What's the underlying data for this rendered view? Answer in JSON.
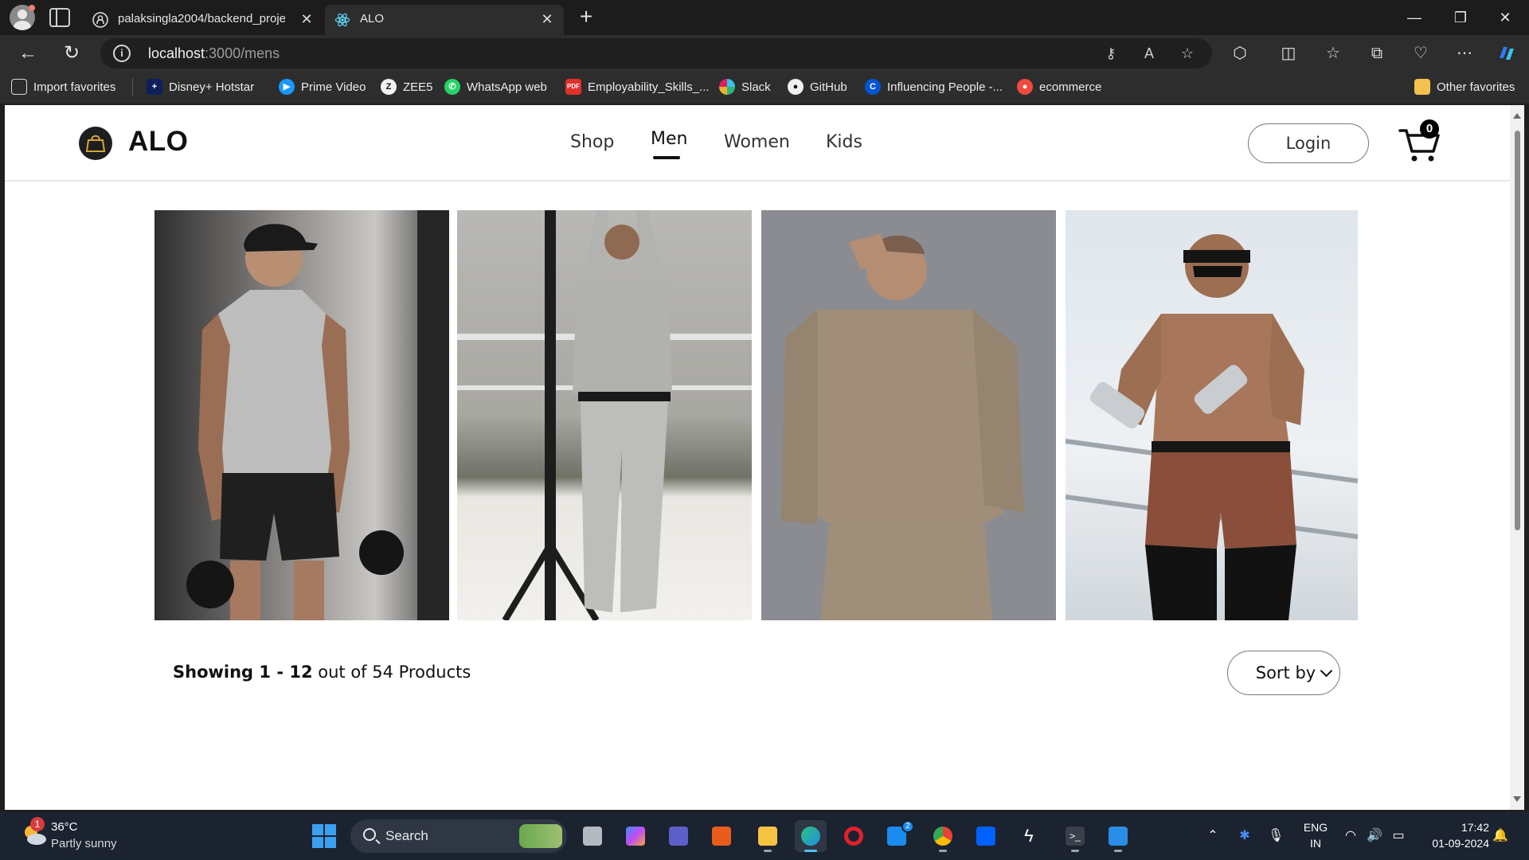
{
  "browser": {
    "tabs": [
      {
        "title": "palaksingla2004/backend_project",
        "icon": "github-icon",
        "active": false
      },
      {
        "title": "ALO",
        "icon": "react-icon",
        "active": true
      }
    ],
    "address": {
      "host": "localhost",
      "path": ":3000/mens"
    },
    "window_controls": {
      "minimize": "—",
      "restore": "❐",
      "close": "✕"
    },
    "favorites": [
      {
        "label": "Import favorites",
        "icon": "import-icon"
      },
      {
        "label": "Disney+ Hotstar",
        "icon": "hotstar-icon"
      },
      {
        "label": "Prime Video",
        "icon": "prime-video-icon"
      },
      {
        "label": "ZEE5",
        "icon": "zee5-icon"
      },
      {
        "label": "WhatsApp web",
        "icon": "whatsapp-icon"
      },
      {
        "label": "Employability_Skills_...",
        "icon": "pdf-icon"
      },
      {
        "label": "Slack",
        "icon": "slack-icon"
      },
      {
        "label": "GitHub",
        "icon": "github-icon"
      },
      {
        "label": "Influencing People -...",
        "icon": "coursera-icon"
      },
      {
        "label": "ecommerce",
        "icon": "ecommerce-icon"
      }
    ],
    "other_favorites": "Other favorites"
  },
  "site": {
    "brand": "ALO",
    "nav": [
      "Shop",
      "Men",
      "Women",
      "Kids"
    ],
    "active_nav": "Men",
    "login_label": "Login",
    "cart_count": "0"
  },
  "products": [
    {
      "alt": "man in grey tank top with kettlebells"
    },
    {
      "alt": "man in grey sweatsuit on rooftop"
    },
    {
      "alt": "man in beige crewneck sweatshirt"
    },
    {
      "alt": "shirtless man in brown shorts with dumbbells"
    }
  ],
  "listing": {
    "showing_prefix": "Showing 1 - 12",
    "showing_suffix": " out of 54 Products",
    "sort_label": "Sort by"
  },
  "taskbar": {
    "weather": {
      "temp": "36°C",
      "desc": "Partly sunny",
      "badge": "1"
    },
    "search_placeholder": "Search",
    "mail_badge": "2",
    "language": {
      "line1": "ENG",
      "line2": "IN"
    },
    "clock": {
      "time": "17:42",
      "date": "01-09-2024"
    }
  }
}
